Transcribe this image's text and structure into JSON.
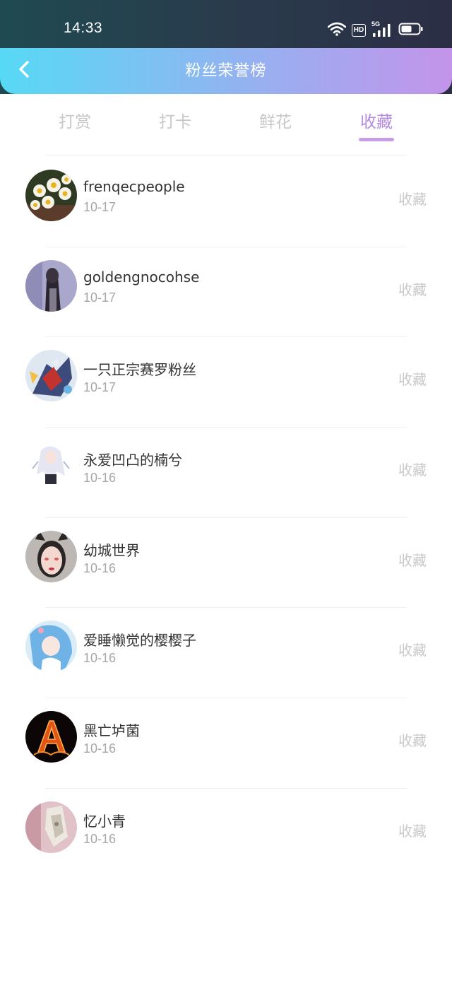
{
  "status_bar": {
    "time": "14:33",
    "icons": [
      "wifi-icon",
      "hd-icon",
      "5g-signal-icon",
      "battery-icon"
    ],
    "hd_label": "HD",
    "network_label": "5G"
  },
  "header": {
    "title": "粉丝荣誉榜",
    "back_icon": "chevron-left-icon"
  },
  "tabs": [
    {
      "label": "打赏",
      "active": false
    },
    {
      "label": "打卡",
      "active": false
    },
    {
      "label": "鲜花",
      "active": false
    },
    {
      "label": "收藏",
      "active": true
    }
  ],
  "list": [
    {
      "name": "frenqecpeople",
      "date": "10-17",
      "action": "收藏",
      "avatar": "narcissus-flowers"
    },
    {
      "name": "goldengnocohse",
      "date": "10-17",
      "action": "收藏",
      "avatar": "dark-haired-figure"
    },
    {
      "name": "一只正宗赛罗粉丝",
      "date": "10-17",
      "action": "收藏",
      "avatar": "ultraman-art"
    },
    {
      "name": "永爱凹凸的楠兮",
      "date": "10-16",
      "action": "收藏",
      "avatar": "anime-girl-white-hair"
    },
    {
      "name": "幼城世界",
      "date": "10-16",
      "action": "收藏",
      "avatar": "girl-cat-ears"
    },
    {
      "name": "爱睡懒觉的樱樱子",
      "date": "10-16",
      "action": "收藏",
      "avatar": "anime-girl-blue-hair"
    },
    {
      "name": "黑亡垆菌",
      "date": "10-16",
      "action": "收藏",
      "avatar": "fire-letter-a"
    },
    {
      "name": "忆小青",
      "date": "10-16",
      "action": "收藏",
      "avatar": "pink-wall-object"
    }
  ],
  "colors": {
    "nav_gradient_start": "#57d9f5",
    "nav_gradient_end": "#c394ea",
    "tab_active": "#b68ae0",
    "tab_inactive": "#c8c8c8",
    "action_text": "#c9c9c9"
  }
}
